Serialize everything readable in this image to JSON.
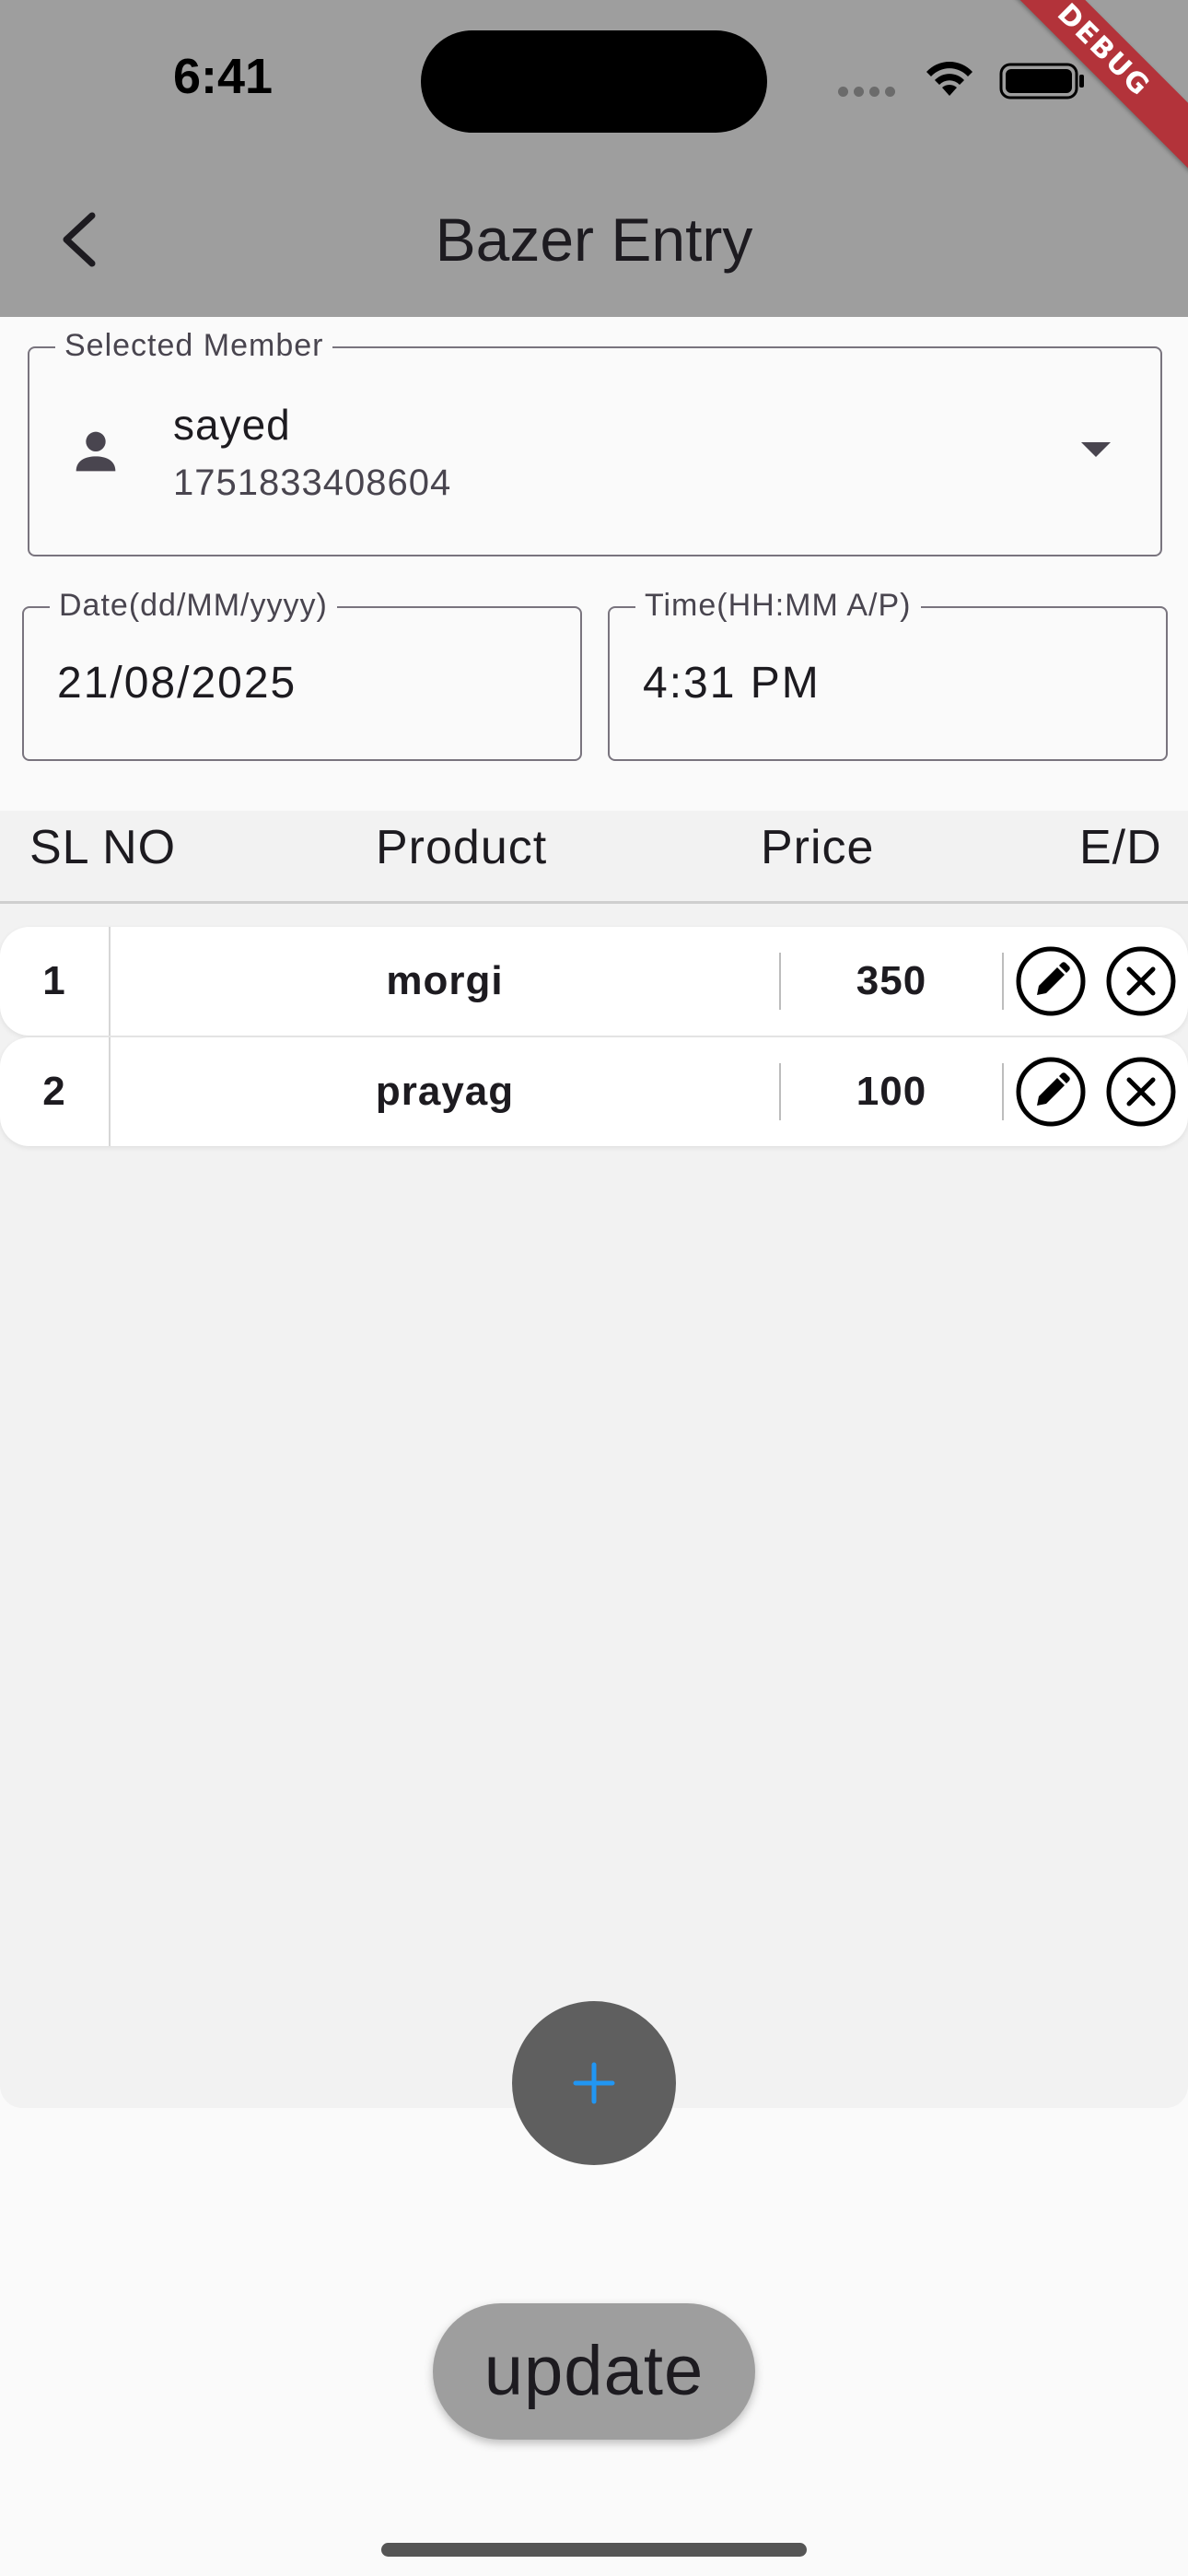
{
  "status_bar": {
    "time": "6:41",
    "debug_label": "DEBUG"
  },
  "app_bar": {
    "title": "Bazer Entry",
    "back_icon": "chevron-left-icon"
  },
  "member_field": {
    "label": "Selected Member",
    "name": "sayed",
    "phone": "1751833408604",
    "icon": "person-icon"
  },
  "date_field": {
    "label": "Date(dd/MM/yyyy)",
    "value": "21/08/2025"
  },
  "time_field": {
    "label": "Time(HH:MM A/P)",
    "value": "4:31 PM"
  },
  "table": {
    "headers": [
      "SL NO",
      "Product",
      "Price",
      "E/D"
    ],
    "rows": [
      {
        "sl": "1",
        "product": "morgi",
        "price": "350"
      },
      {
        "sl": "2",
        "product": "prayag",
        "price": "100"
      }
    ]
  },
  "fab": {
    "icon": "plus-icon",
    "color": "#2196f3"
  },
  "update_button": {
    "label": "update"
  },
  "colors": {
    "app_bar": "#9e9e9e",
    "fab_bg": "#5f5f5f",
    "debug_ribbon": "#b3333a"
  }
}
